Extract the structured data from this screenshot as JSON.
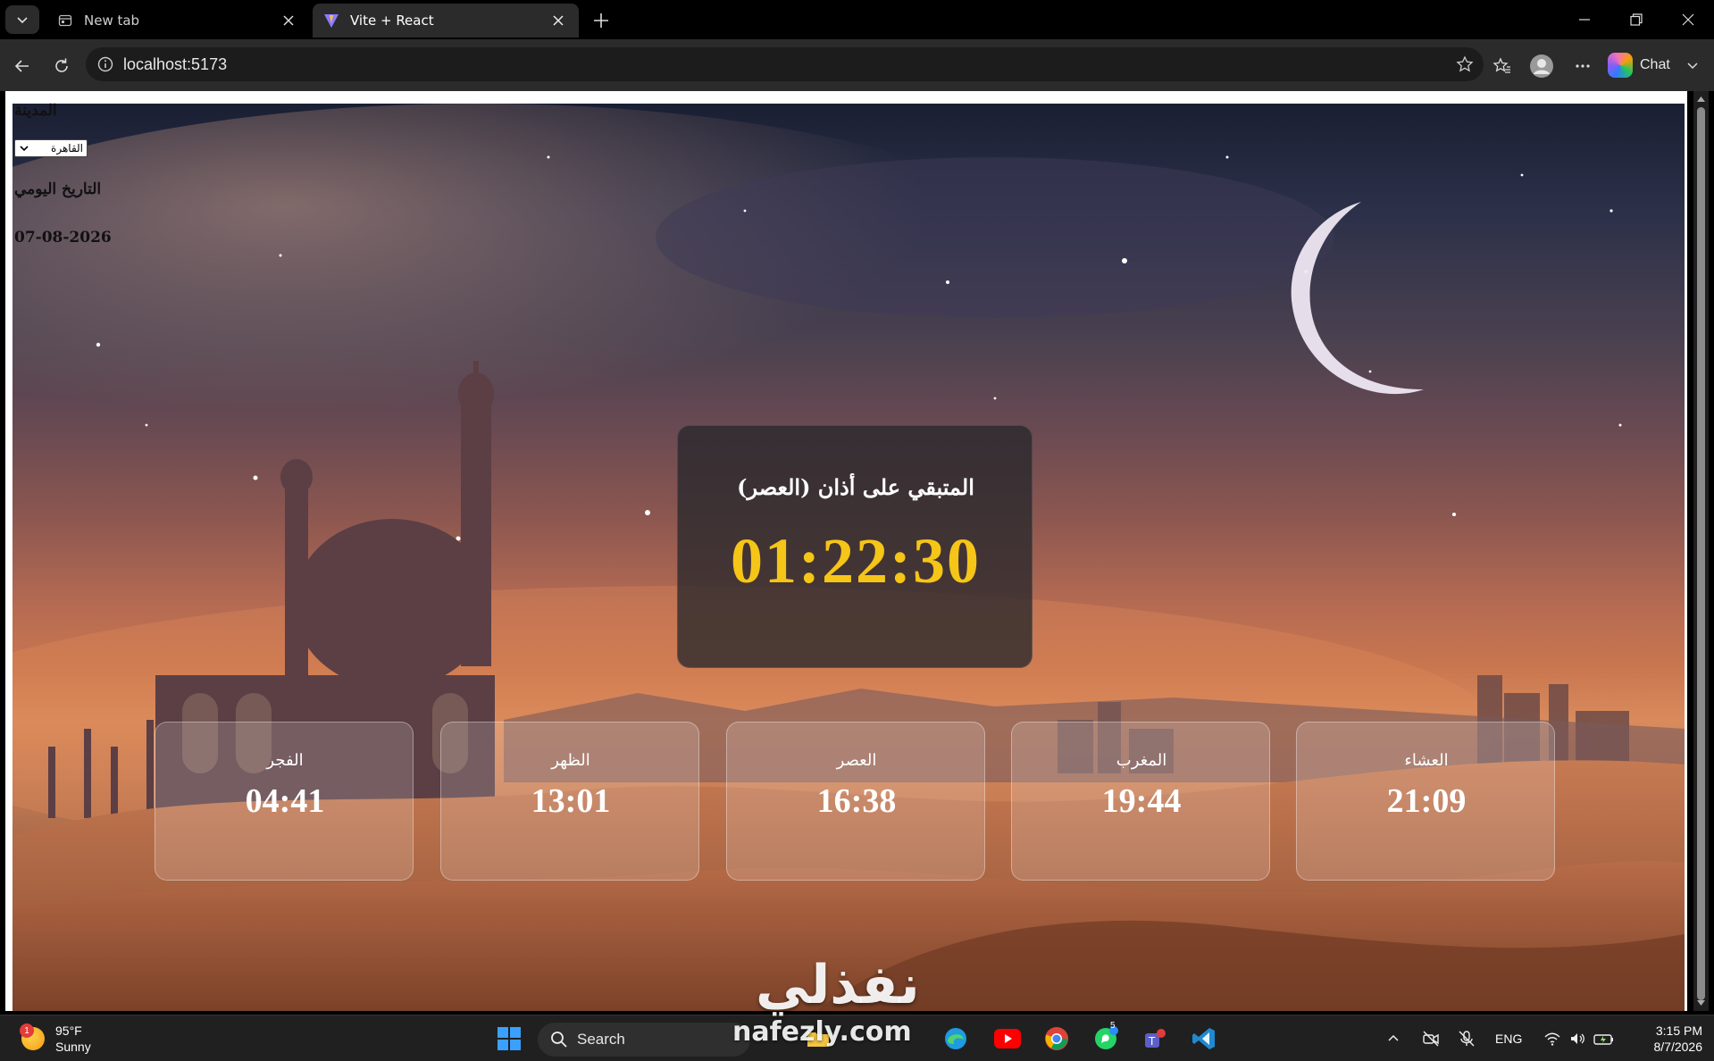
{
  "browser": {
    "tabs": [
      {
        "title": "New tab",
        "icon": "new-tab-page-icon",
        "active": false
      },
      {
        "title": "Vite + React",
        "icon": "vite-logo-icon",
        "active": true
      }
    ],
    "url": "localhost:5173",
    "chat_label": "Chat"
  },
  "app": {
    "city_label": "المدينة",
    "city_selected": "القاهرة",
    "date_label": "التاريخ اليومي",
    "date_value": "07-08-2026",
    "countdown_label": "المتبقي على أذان (العصر)",
    "countdown_time": "01:22:30",
    "prayers": [
      {
        "name": "الفجر",
        "time": "04:41"
      },
      {
        "name": "الظهر",
        "time": "13:01"
      },
      {
        "name": "العصر",
        "time": "16:38"
      },
      {
        "name": "المغرب",
        "time": "19:44"
      },
      {
        "name": "العشاء",
        "time": "21:09"
      }
    ],
    "watermark": "نفذلي",
    "watermark_sub": "nafezly.com",
    "colors": {
      "countdown_time": "#f5c518"
    }
  },
  "taskbar": {
    "weather_temp": "95°F",
    "weather_desc": "Sunny",
    "weather_badge": "1",
    "search_label": "Search",
    "whatsapp_badge": "5",
    "lang": "ENG",
    "time": "3:15 PM",
    "date": "8/7/2026"
  }
}
